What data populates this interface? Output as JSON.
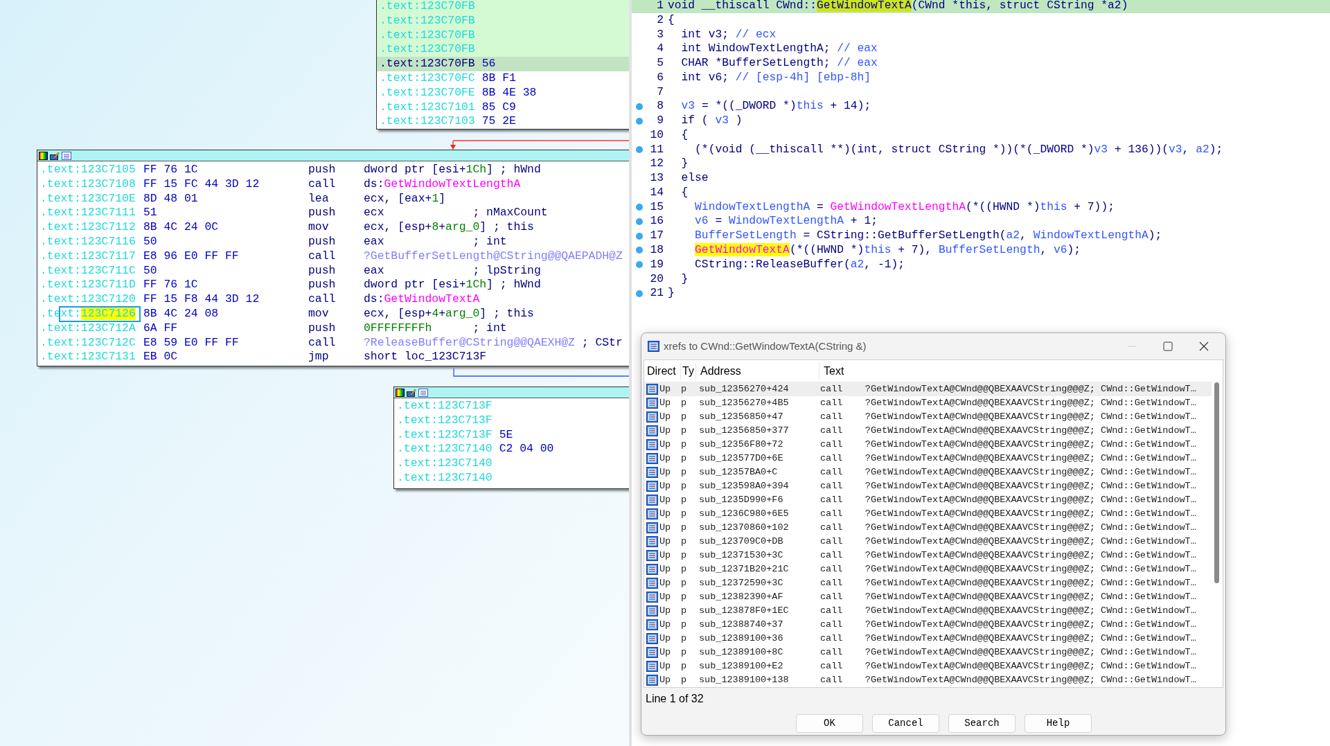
{
  "graph": {
    "top_node": {
      "rows": [
        {
          "section": ".text:",
          "address": "123C70FB",
          "highlighted": true,
          "selected": false
        },
        {
          "section": ".text:",
          "address": "123C70FB",
          "highlighted": true,
          "selected": false
        },
        {
          "section": ".text:",
          "address": "123C70FB",
          "highlighted": true,
          "selected": false
        },
        {
          "section": ".text:",
          "address": "123C70FB",
          "highlighted": true,
          "selected": false
        },
        {
          "section": ".text:",
          "address": "123C70FB",
          "bytes": "56",
          "highlighted": true,
          "selected": true
        },
        {
          "section": ".text:",
          "address": "123C70FC",
          "bytes": "8B F1",
          "highlighted": false,
          "selected": false
        },
        {
          "section": ".text:",
          "address": "123C70FE",
          "bytes": "8B 4E 38",
          "highlighted": false,
          "selected": false
        },
        {
          "section": ".text:",
          "address": "123C7101",
          "bytes": "85 C9",
          "highlighted": false,
          "selected": false
        },
        {
          "section": ".text:",
          "address": "123C7103",
          "bytes": "75 2E",
          "highlighted": false,
          "selected": false
        }
      ]
    },
    "main_node": {
      "rows": [
        {
          "section": ".text:",
          "address": "123C7105",
          "bytes": "FF 76 1C",
          "mnemonic": "push",
          "operands": [
            {
              "text": "dword ptr [esi+",
              "kind": "p"
            },
            {
              "text": "1Ch",
              "kind": "n"
            },
            {
              "text": "] ; hWnd",
              "kind": "p"
            }
          ],
          "cursor": false
        },
        {
          "section": ".text:",
          "address": "123C7108",
          "bytes": "FF 15 FC 44 3D 12",
          "mnemonic": "call",
          "operands": [
            {
              "text": "ds:",
              "kind": "p"
            },
            {
              "text": "GetWindowTextLengthA",
              "kind": "i"
            }
          ],
          "cursor": false
        },
        {
          "section": ".text:",
          "address": "123C710E",
          "bytes": "8D 48 01",
          "mnemonic": "lea",
          "operands": [
            {
              "text": "ecx, [eax+",
              "kind": "p"
            },
            {
              "text": "1",
              "kind": "n"
            },
            {
              "text": "]",
              "kind": "p"
            }
          ],
          "cursor": false
        },
        {
          "section": ".text:",
          "address": "123C7111",
          "bytes": "51",
          "mnemonic": "push",
          "operands": [
            {
              "text": "ecx             ; nMaxCount",
              "kind": "p"
            }
          ],
          "cursor": false
        },
        {
          "section": ".text:",
          "address": "123C7112",
          "bytes": "8B 4C 24 0C",
          "mnemonic": "mov",
          "operands": [
            {
              "text": "ecx, [esp+",
              "kind": "p"
            },
            {
              "text": "8",
              "kind": "n"
            },
            {
              "text": "+",
              "kind": "p"
            },
            {
              "text": "arg_0",
              "kind": "n"
            },
            {
              "text": "] ; this",
              "kind": "p"
            }
          ],
          "cursor": false
        },
        {
          "section": ".text:",
          "address": "123C7116",
          "bytes": "50",
          "mnemonic": "push",
          "operands": [
            {
              "text": "eax             ; int",
              "kind": "p"
            }
          ],
          "cursor": false
        },
        {
          "section": ".text:",
          "address": "123C7117",
          "bytes": "E8 96 E0 FF FF",
          "mnemonic": "call",
          "operands": [
            {
              "text": "?GetBufferSetLength@CString@@QAEPADH@Z",
              "kind": "f"
            }
          ],
          "cursor": false
        },
        {
          "section": ".text:",
          "address": "123C711C",
          "bytes": "50",
          "mnemonic": "push",
          "operands": [
            {
              "text": "eax             ; lpString",
              "kind": "p"
            }
          ],
          "cursor": false
        },
        {
          "section": ".text:",
          "address": "123C711D",
          "bytes": "FF 76 1C",
          "mnemonic": "push",
          "operands": [
            {
              "text": "dword ptr [esi+",
              "kind": "p"
            },
            {
              "text": "1Ch",
              "kind": "n"
            },
            {
              "text": "] ; hWnd",
              "kind": "p"
            }
          ],
          "cursor": false
        },
        {
          "section": ".text:",
          "address": "123C7120",
          "bytes": "FF 15 F8 44 3D 12",
          "mnemonic": "call",
          "operands": [
            {
              "text": "ds:",
              "kind": "p"
            },
            {
              "text": "GetWindowTextA",
              "kind": "i"
            }
          ],
          "cursor": false
        },
        {
          "section": ".text:",
          "address": "123C7126",
          "bytes": "8B 4C 24 08",
          "mnemonic": "mov",
          "operands": [
            {
              "text": "ecx, [esp+",
              "kind": "p"
            },
            {
              "text": "4",
              "kind": "n"
            },
            {
              "text": "+",
              "kind": "p"
            },
            {
              "text": "arg_0",
              "kind": "n"
            },
            {
              "text": "] ; this",
              "kind": "p"
            }
          ],
          "cursor": true
        },
        {
          "section": ".text:",
          "address": "123C712A",
          "bytes": "6A FF",
          "mnemonic": "push",
          "operands": [
            {
              "text": "0FFFFFFFFh",
              "kind": "n"
            },
            {
              "text": "      ; int",
              "kind": "p"
            }
          ],
          "cursor": false
        },
        {
          "section": ".text:",
          "address": "123C712C",
          "bytes": "E8 59 E0 FF FF",
          "mnemonic": "call",
          "operands": [
            {
              "text": "?ReleaseBuffer@CString@@QAEXH@Z",
              "kind": "f"
            },
            {
              "text": " ; CStr",
              "kind": "p"
            }
          ],
          "cursor": false
        },
        {
          "section": ".text:",
          "address": "123C7131",
          "bytes": "EB 0C",
          "mnemonic": "jmp",
          "operands": [
            {
              "text": "short loc_123C713F",
              "kind": "p"
            }
          ],
          "cursor": false
        }
      ]
    },
    "bottom_node": {
      "rows": [
        {
          "section": ".text:",
          "address": "123C713F"
        },
        {
          "section": ".text:",
          "address": "123C713F"
        },
        {
          "section": ".text:",
          "address": "123C713F",
          "bytes": "5E"
        },
        {
          "section": ".text:",
          "address": "123C7140",
          "bytes": "C2 04 00"
        },
        {
          "section": ".text:",
          "address": "123C7140"
        },
        {
          "section": ".text:",
          "address": "123C7140"
        }
      ]
    }
  },
  "pseudocode": {
    "lines": [
      {
        "number": "1",
        "breakpoint": false,
        "selected": true,
        "code": [
          {
            "text": "void __thiscall CWnd::",
            "kind": "p"
          },
          {
            "text": "GetWindowTextA",
            "kind": "hl"
          },
          {
            "text": "(CWnd *this, struct CString *a2)",
            "kind": "p"
          }
        ]
      },
      {
        "number": "2",
        "breakpoint": false,
        "selected": false,
        "code": [
          {
            "text": "{",
            "kind": "p"
          }
        ]
      },
      {
        "number": "3",
        "breakpoint": false,
        "selected": false,
        "code": [
          {
            "text": "  int v3; ",
            "kind": "p"
          },
          {
            "text": "// ecx",
            "kind": "c"
          }
        ]
      },
      {
        "number": "4",
        "breakpoint": false,
        "selected": false,
        "code": [
          {
            "text": "  int WindowTextLengthA; ",
            "kind": "p"
          },
          {
            "text": "// eax",
            "kind": "c"
          }
        ]
      },
      {
        "number": "5",
        "breakpoint": false,
        "selected": false,
        "code": [
          {
            "text": "  CHAR *BufferSetLength; ",
            "kind": "p"
          },
          {
            "text": "// eax",
            "kind": "c"
          }
        ]
      },
      {
        "number": "6",
        "breakpoint": false,
        "selected": false,
        "code": [
          {
            "text": "  int v6; ",
            "kind": "p"
          },
          {
            "text": "// [esp-4h] [ebp-8h]",
            "kind": "c"
          }
        ]
      },
      {
        "number": "7",
        "breakpoint": false,
        "selected": false
      },
      {
        "number": "8",
        "breakpoint": true,
        "selected": false,
        "code": [
          {
            "text": "  v3",
            "kind": "v"
          },
          {
            "text": " = *((_DWORD *)",
            "kind": "p"
          },
          {
            "text": "this",
            "kind": "v"
          },
          {
            "text": " + 14);",
            "kind": "p"
          }
        ]
      },
      {
        "number": "9",
        "breakpoint": true,
        "selected": false,
        "code": [
          {
            "text": "  if ( ",
            "kind": "p"
          },
          {
            "text": "v3",
            "kind": "v"
          },
          {
            "text": " )",
            "kind": "p"
          }
        ]
      },
      {
        "number": "10",
        "breakpoint": false,
        "selected": false,
        "code": [
          {
            "text": "  {",
            "kind": "p"
          }
        ]
      },
      {
        "number": "11",
        "breakpoint": true,
        "selected": false,
        "code": [
          {
            "text": "    (*(void (__thiscall **)(int, struct CString *))(*(_DWORD *)",
            "kind": "p"
          },
          {
            "text": "v3",
            "kind": "v"
          },
          {
            "text": " + 136))(",
            "kind": "p"
          },
          {
            "text": "v3",
            "kind": "v"
          },
          {
            "text": ", ",
            "kind": "p"
          },
          {
            "text": "a2",
            "kind": "v"
          },
          {
            "text": ");",
            "kind": "p"
          }
        ]
      },
      {
        "number": "12",
        "breakpoint": false,
        "selected": false,
        "code": [
          {
            "text": "  }",
            "kind": "p"
          }
        ]
      },
      {
        "number": "13",
        "breakpoint": false,
        "selected": false,
        "code": [
          {
            "text": "  else",
            "kind": "p"
          }
        ]
      },
      {
        "number": "14",
        "breakpoint": false,
        "selected": false,
        "code": [
          {
            "text": "  {",
            "kind": "p"
          }
        ]
      },
      {
        "number": "15",
        "breakpoint": true,
        "selected": false,
        "code": [
          {
            "text": "    WindowTextLengthA",
            "kind": "v"
          },
          {
            "text": " = ",
            "kind": "p"
          },
          {
            "text": "GetWindowTextLengthA",
            "kind": "i"
          },
          {
            "text": "(*((HWND *)",
            "kind": "p"
          },
          {
            "text": "this",
            "kind": "v"
          },
          {
            "text": " + 7));",
            "kind": "p"
          }
        ]
      },
      {
        "number": "16",
        "breakpoint": true,
        "selected": false,
        "code": [
          {
            "text": "    v6",
            "kind": "v"
          },
          {
            "text": " = ",
            "kind": "p"
          },
          {
            "text": "WindowTextLengthA",
            "kind": "v"
          },
          {
            "text": " + 1;",
            "kind": "p"
          }
        ]
      },
      {
        "number": "17",
        "breakpoint": true,
        "selected": false,
        "code": [
          {
            "text": "    BufferSetLength",
            "kind": "v"
          },
          {
            "text": " = CString::GetBufferSetLength(",
            "kind": "p"
          },
          {
            "text": "a2",
            "kind": "v"
          },
          {
            "text": ", ",
            "kind": "p"
          },
          {
            "text": "WindowTextLengthA",
            "kind": "v"
          },
          {
            "text": ");",
            "kind": "p"
          }
        ]
      },
      {
        "number": "18",
        "breakpoint": true,
        "selected": false,
        "code": [
          {
            "text": "    GetWindowTextA",
            "kind": "hli"
          },
          {
            "text": "(*((HWND *)",
            "kind": "p"
          },
          {
            "text": "this",
            "kind": "v"
          },
          {
            "text": " + 7), ",
            "kind": "p"
          },
          {
            "text": "BufferSetLength",
            "kind": "v"
          },
          {
            "text": ", ",
            "kind": "p"
          },
          {
            "text": "v6",
            "kind": "v"
          },
          {
            "text": ");",
            "kind": "p"
          }
        ]
      },
      {
        "number": "19",
        "breakpoint": true,
        "selected": false,
        "code": [
          {
            "text": "    CString::ReleaseBuffer(",
            "kind": "p"
          },
          {
            "text": "a2",
            "kind": "v"
          },
          {
            "text": ", -1);",
            "kind": "p"
          }
        ]
      },
      {
        "number": "20",
        "breakpoint": false,
        "selected": false,
        "code": [
          {
            "text": "  }",
            "kind": "p"
          }
        ]
      },
      {
        "number": "21",
        "breakpoint": true,
        "selected": false,
        "code": [
          {
            "text": "}",
            "kind": "p"
          }
        ]
      }
    ]
  },
  "xrefs_dialog": {
    "title": "xrefs to CWnd::GetWindowTextA(CString &)",
    "columns": [
      "Direct",
      "Ty",
      "Address",
      "Text"
    ],
    "rows": [
      {
        "direction": "Up",
        "type": "p",
        "address": "sub_12356270+424",
        "text": "call    ?GetWindowTextA@CWnd@@QBEXAAVCString@@@Z; CWnd::GetWindowT…",
        "selected": true
      },
      {
        "direction": "Up",
        "type": "p",
        "address": "sub_12356270+4B5",
        "text": "call    ?GetWindowTextA@CWnd@@QBEXAAVCString@@@Z; CWnd::GetWindowT…",
        "selected": false
      },
      {
        "direction": "Up",
        "type": "p",
        "address": "sub_12356850+47",
        "text": "call    ?GetWindowTextA@CWnd@@QBEXAAVCString@@@Z; CWnd::GetWindowT…",
        "selected": false
      },
      {
        "direction": "Up",
        "type": "p",
        "address": "sub_12356850+377",
        "text": "call    ?GetWindowTextA@CWnd@@QBEXAAVCString@@@Z; CWnd::GetWindowT…",
        "selected": false
      },
      {
        "direction": "Up",
        "type": "p",
        "address": "sub_12356F80+72",
        "text": "call    ?GetWindowTextA@CWnd@@QBEXAAVCString@@@Z; CWnd::GetWindowT…",
        "selected": false
      },
      {
        "direction": "Up",
        "type": "p",
        "address": "sub_123577D0+6E",
        "text": "call    ?GetWindowTextA@CWnd@@QBEXAAVCString@@@Z; CWnd::GetWindowT…",
        "selected": false
      },
      {
        "direction": "Up",
        "type": "p",
        "address": "sub_12357BA0+C",
        "text": "call    ?GetWindowTextA@CWnd@@QBEXAAVCString@@@Z; CWnd::GetWindowT…",
        "selected": false
      },
      {
        "direction": "Up",
        "type": "p",
        "address": "sub_123598A0+394",
        "text": "call    ?GetWindowTextA@CWnd@@QBEXAAVCString@@@Z; CWnd::GetWindowT…",
        "selected": false
      },
      {
        "direction": "Up",
        "type": "p",
        "address": "sub_1235D990+F6",
        "text": "call    ?GetWindowTextA@CWnd@@QBEXAAVCString@@@Z; CWnd::GetWindowT…",
        "selected": false
      },
      {
        "direction": "Up",
        "type": "p",
        "address": "sub_1236C980+6E5",
        "text": "call    ?GetWindowTextA@CWnd@@QBEXAAVCString@@@Z; CWnd::GetWindowT…",
        "selected": false
      },
      {
        "direction": "Up",
        "type": "p",
        "address": "sub_12370860+102",
        "text": "call    ?GetWindowTextA@CWnd@@QBEXAAVCString@@@Z; CWnd::GetWindowT…",
        "selected": false
      },
      {
        "direction": "Up",
        "type": "p",
        "address": "sub_123709C0+DB",
        "text": "call    ?GetWindowTextA@CWnd@@QBEXAAVCString@@@Z; CWnd::GetWindowT…",
        "selected": false
      },
      {
        "direction": "Up",
        "type": "p",
        "address": "sub_12371530+3C",
        "text": "call    ?GetWindowTextA@CWnd@@QBEXAAVCString@@@Z; CWnd::GetWindowT…",
        "selected": false
      },
      {
        "direction": "Up",
        "type": "p",
        "address": "sub_12371B20+21C",
        "text": "call    ?GetWindowTextA@CWnd@@QBEXAAVCString@@@Z; CWnd::GetWindowT…",
        "selected": false
      },
      {
        "direction": "Up",
        "type": "p",
        "address": "sub_12372590+3C",
        "text": "call    ?GetWindowTextA@CWnd@@QBEXAAVCString@@@Z; CWnd::GetWindowT…",
        "selected": false
      },
      {
        "direction": "Up",
        "type": "p",
        "address": "sub_12382390+AF",
        "text": "call    ?GetWindowTextA@CWnd@@QBEXAAVCString@@@Z; CWnd::GetWindowT…",
        "selected": false
      },
      {
        "direction": "Up",
        "type": "p",
        "address": "sub_123878F0+1EC",
        "text": "call    ?GetWindowTextA@CWnd@@QBEXAAVCString@@@Z; CWnd::GetWindowT…",
        "selected": false
      },
      {
        "direction": "Up",
        "type": "p",
        "address": "sub_12388740+37",
        "text": "call    ?GetWindowTextA@CWnd@@QBEXAAVCString@@@Z; CWnd::GetWindowT…",
        "selected": false
      },
      {
        "direction": "Up",
        "type": "p",
        "address": "sub_12389100+36",
        "text": "call    ?GetWindowTextA@CWnd@@QBEXAAVCString@@@Z; CWnd::GetWindowT…",
        "selected": false
      },
      {
        "direction": "Up",
        "type": "p",
        "address": "sub_12389100+8C",
        "text": "call    ?GetWindowTextA@CWnd@@QBEXAAVCString@@@Z; CWnd::GetWindowT…",
        "selected": false
      },
      {
        "direction": "Up",
        "type": "p",
        "address": "sub_12389100+E2",
        "text": "call    ?GetWindowTextA@CWnd@@QBEXAAVCString@@@Z; CWnd::GetWindowT…",
        "selected": false
      },
      {
        "direction": "Up",
        "type": "p",
        "address": "sub_12389100+138",
        "text": "call    ?GetWindowTextA@CWnd@@QBEXAAVCString@@@Z; CWnd::GetWindowT…",
        "selected": false
      }
    ],
    "status": "Line 1 of 32",
    "buttons": [
      "OK",
      "Cancel",
      "Search",
      "Help"
    ]
  }
}
